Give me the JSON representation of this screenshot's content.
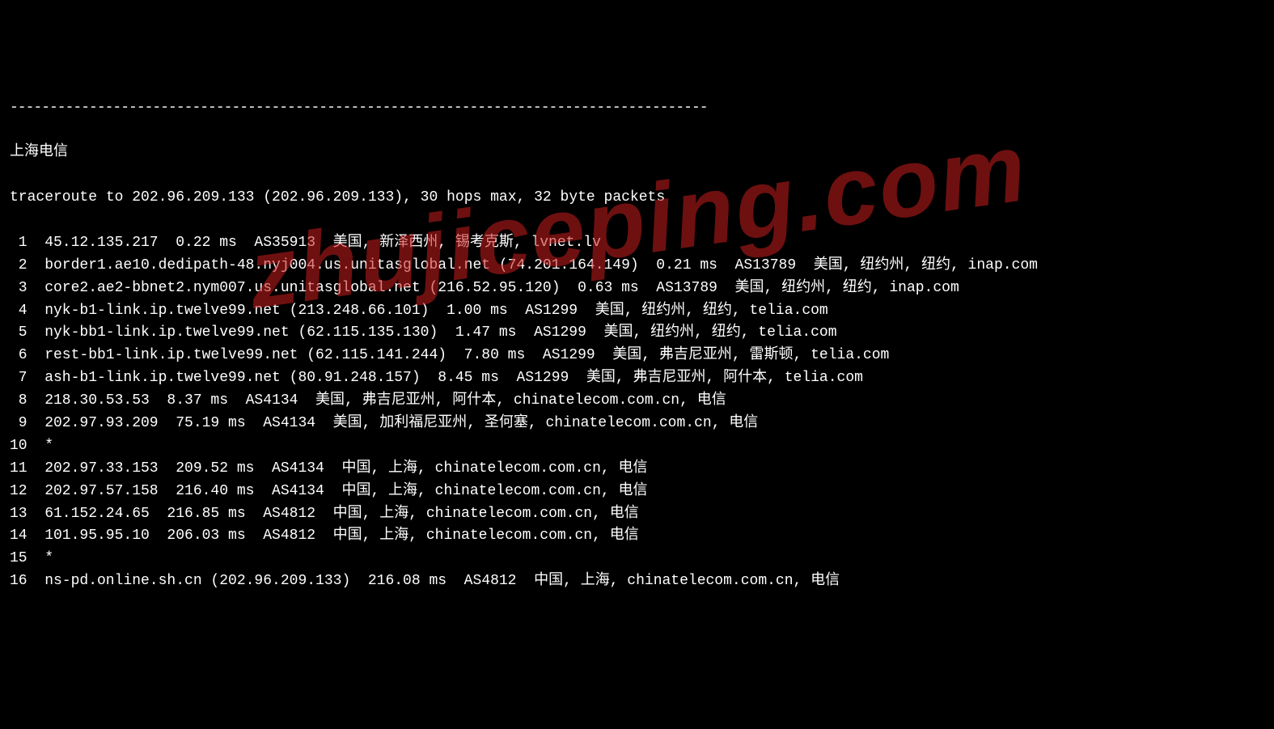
{
  "separator": "----------------------------------------------------------------------------------------",
  "header_label": "上海电信",
  "trace_header": "traceroute to 202.96.209.133 (202.96.209.133), 30 hops max, 32 byte packets",
  "watermark": "zhujiceping.com",
  "hops": [
    {
      "num": "1",
      "line": "45.12.135.217  0.22 ms  AS35913  美国, 新泽西州, 锡考克斯, lvnet.lv"
    },
    {
      "num": "2",
      "line": "border1.ae10.dedipath-48.nyj004.us.unitasglobal.net (74.201.164.149)  0.21 ms  AS13789  美国, 纽约州, 纽约, inap.com"
    },
    {
      "num": "3",
      "line": "core2.ae2-bbnet2.nym007.us.unitasglobal.net (216.52.95.120)  0.63 ms  AS13789  美国, 纽约州, 纽约, inap.com"
    },
    {
      "num": "4",
      "line": "nyk-b1-link.ip.twelve99.net (213.248.66.101)  1.00 ms  AS1299  美国, 纽约州, 纽约, telia.com"
    },
    {
      "num": "5",
      "line": "nyk-bb1-link.ip.twelve99.net (62.115.135.130)  1.47 ms  AS1299  美国, 纽约州, 纽约, telia.com"
    },
    {
      "num": "6",
      "line": "rest-bb1-link.ip.twelve99.net (62.115.141.244)  7.80 ms  AS1299  美国, 弗吉尼亚州, 雷斯顿, telia.com"
    },
    {
      "num": "7",
      "line": "ash-b1-link.ip.twelve99.net (80.91.248.157)  8.45 ms  AS1299  美国, 弗吉尼亚州, 阿什本, telia.com"
    },
    {
      "num": "8",
      "line": "218.30.53.53  8.37 ms  AS4134  美国, 弗吉尼亚州, 阿什本, chinatelecom.com.cn, 电信"
    },
    {
      "num": "9",
      "line": "202.97.93.209  75.19 ms  AS4134  美国, 加利福尼亚州, 圣何塞, chinatelecom.com.cn, 电信"
    },
    {
      "num": "10",
      "line": "*"
    },
    {
      "num": "11",
      "line": "202.97.33.153  209.52 ms  AS4134  中国, 上海, chinatelecom.com.cn, 电信"
    },
    {
      "num": "12",
      "line": "202.97.57.158  216.40 ms  AS4134  中国, 上海, chinatelecom.com.cn, 电信"
    },
    {
      "num": "13",
      "line": "61.152.24.65  216.85 ms  AS4812  中国, 上海, chinatelecom.com.cn, 电信"
    },
    {
      "num": "14",
      "line": "101.95.95.10  206.03 ms  AS4812  中国, 上海, chinatelecom.com.cn, 电信"
    },
    {
      "num": "15",
      "line": "*"
    },
    {
      "num": "16",
      "line": "ns-pd.online.sh.cn (202.96.209.133)  216.08 ms  AS4812  中国, 上海, chinatelecom.com.cn, 电信"
    }
  ]
}
